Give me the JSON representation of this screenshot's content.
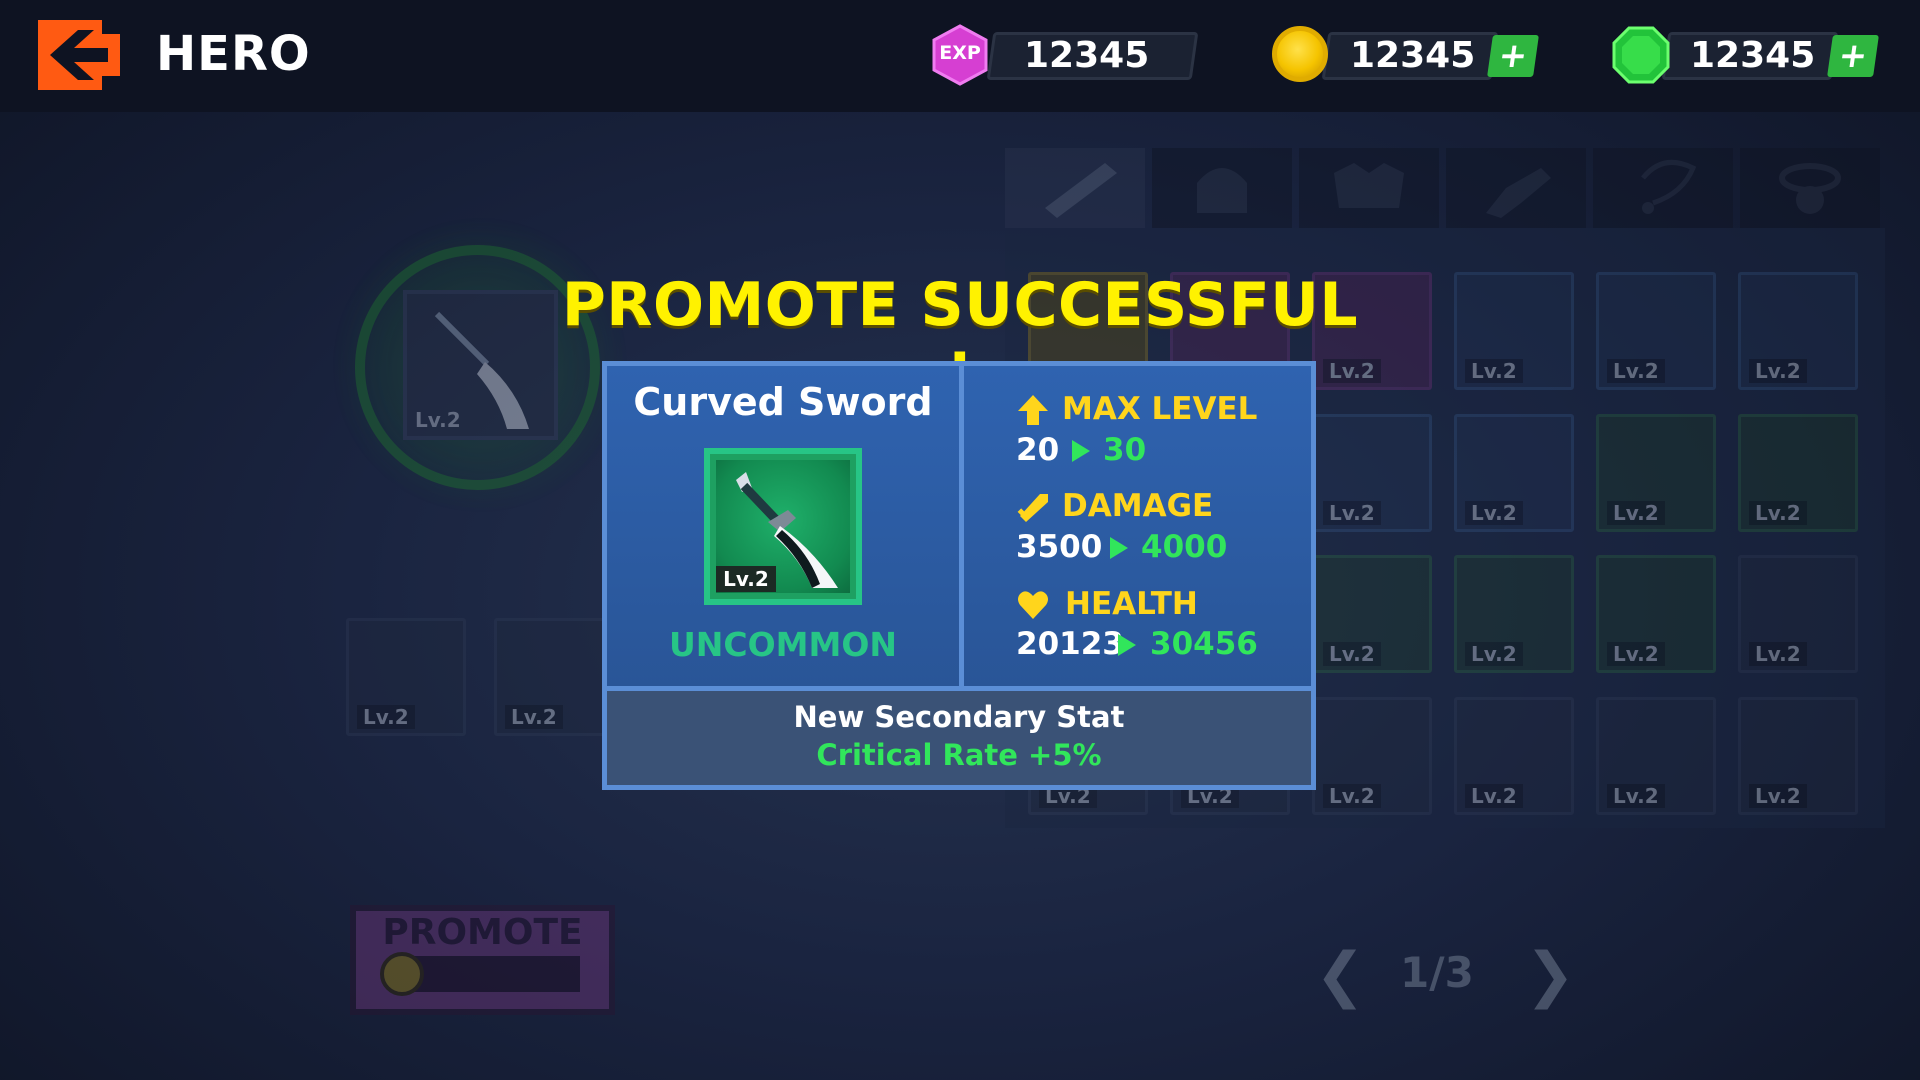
{
  "header": {
    "title": "HERO"
  },
  "resources": {
    "exp": {
      "icon": "exp-badge-icon",
      "label": "EXP",
      "value": "12345"
    },
    "gold": {
      "icon": "gold-coin-icon",
      "value": "12345",
      "plus": "+"
    },
    "gems": {
      "icon": "green-gem-icon",
      "value": "12345",
      "plus": "+"
    }
  },
  "inventory": {
    "tabs": [
      {
        "icon": "sword-tab-icon"
      },
      {
        "icon": "helmet-tab-icon"
      },
      {
        "icon": "armor-tab-icon"
      },
      {
        "icon": "gauntlet-tab-icon"
      },
      {
        "icon": "necklace-tab-icon"
      },
      {
        "icon": "ring-tab-icon"
      }
    ],
    "slot_level": "Lv.2",
    "pager": {
      "text": "1/3"
    }
  },
  "equipped": {
    "level": "Lv.2"
  },
  "promote_button": {
    "label": "PROMOTE"
  },
  "popup": {
    "title": "PROMOTE SUCCESSFUL !",
    "item": {
      "name": "Curved Sword",
      "level": "Lv.2",
      "rarity": "UNCOMMON",
      "icon": "curved-sword-icon"
    },
    "stats": [
      {
        "icon": "arrow-up-icon",
        "label": "MAX LEVEL",
        "old": "20",
        "new": "30"
      },
      {
        "icon": "sword-icon",
        "label": "DAMAGE",
        "old": "3500",
        "new": "4000"
      },
      {
        "icon": "heart-icon",
        "label": "HEALTH",
        "old": "20123",
        "new": "30456"
      }
    ],
    "secondary": {
      "label": "New Secondary Stat",
      "value": "Critical Rate +5%"
    }
  },
  "colors": {
    "accent_yellow": "#fff200",
    "stat_label": "#ffd51c",
    "stat_new": "#31e65b",
    "rarity_uncommon": "#27c586",
    "popup_bg": "#2c5fa8",
    "popup_border": "#5b8ed6",
    "back_button": "#ff5a12"
  }
}
